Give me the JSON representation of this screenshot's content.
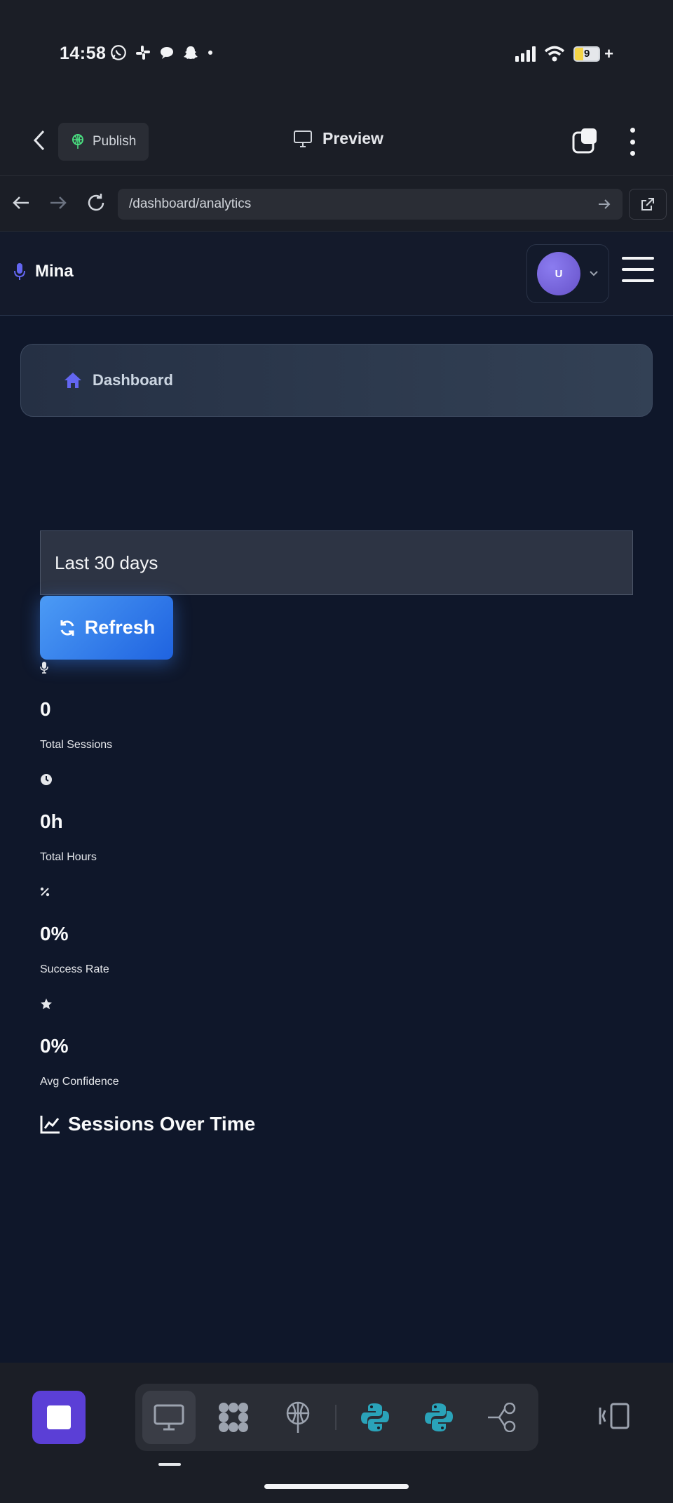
{
  "status_bar": {
    "time": "14:58",
    "app_icons": [
      "whatsapp-icon",
      "slack-icon",
      "chat-icon",
      "snapchat-icon",
      "dot-icon"
    ],
    "battery_level": "9"
  },
  "app_header": {
    "publish_label": "Publish",
    "preview_label": "Preview"
  },
  "browser": {
    "url": "/dashboard/analytics"
  },
  "app_nav": {
    "brand_name": "Mina",
    "avatar_initial": "U"
  },
  "breadcrumb": {
    "label": "Dashboard"
  },
  "filters": {
    "date_range": "Last 30 days",
    "refresh_label": "Refresh"
  },
  "stats": [
    {
      "icon": "microphone-icon",
      "value": "0",
      "label": "Total Sessions"
    },
    {
      "icon": "clock-icon",
      "value": "0h",
      "label": "Total Hours"
    },
    {
      "icon": "percent-icon",
      "value": "0%",
      "label": "Success Rate"
    },
    {
      "icon": "star-icon",
      "value": "0%",
      "label": "Avg Confidence"
    }
  ],
  "sessions_chart": {
    "title": "Sessions Over Time"
  },
  "colors": {
    "accent": "#6366f1",
    "primary_button": "#2563eb",
    "stop_button": "#5b3fd6",
    "background": "#0f172a"
  }
}
